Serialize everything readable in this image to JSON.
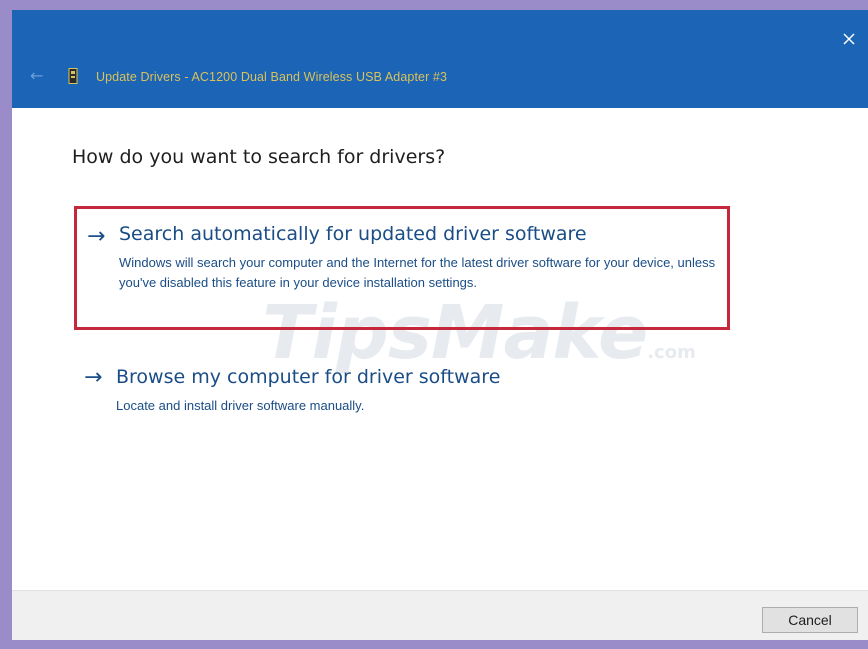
{
  "window": {
    "title": "Update Drivers - AC1200  Dual Band Wireless USB Adapter #3",
    "accent_color": "#1b64b6",
    "back_icon": "back-arrow-icon",
    "device_icon": "usb-adapter-icon",
    "close_icon": "close-icon"
  },
  "main": {
    "heading": "How do you want to search for drivers?",
    "options": [
      {
        "arrow": "→",
        "title": "Search automatically for updated driver software",
        "description": "Windows will search your computer and the Internet for the latest driver software for your device, unless you've disabled this feature in your device installation settings.",
        "highlight_color": "#c5283a"
      },
      {
        "arrow": "→",
        "title": "Browse my computer for driver software",
        "description": "Locate and install driver software manually."
      }
    ]
  },
  "watermark": {
    "brand": "TipsMake",
    "suffix": ".com"
  },
  "footer": {
    "cancel_label": "Cancel"
  }
}
